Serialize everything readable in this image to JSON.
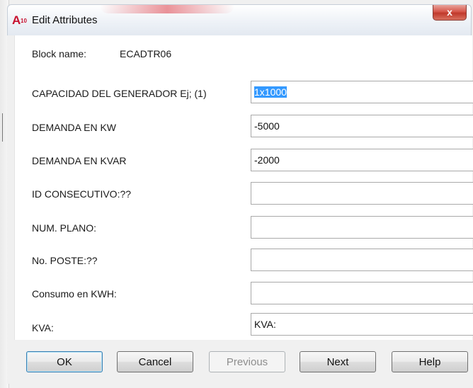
{
  "window": {
    "title": "Edit Attributes",
    "icon_text": "A",
    "icon_subtext": "10",
    "close_label": "x"
  },
  "block": {
    "label": "Block name:",
    "value": "ECADTR06"
  },
  "attributes": [
    {
      "label": "CAPACIDAD DEL GENERADOR Ej; (1)",
      "value": "1x1000",
      "selected": true
    },
    {
      "label": "DEMANDA EN KW",
      "value": "-5000"
    },
    {
      "label": "DEMANDA EN KVAR",
      "value": "-2000"
    },
    {
      "label": "ID CONSECUTIVO:??",
      "value": ""
    },
    {
      "label": "NUM. PLANO:",
      "value": ""
    },
    {
      "label": "No. POSTE:??",
      "value": ""
    },
    {
      "label": "Consumo en KWH:",
      "value": ""
    },
    {
      "label": "KVA:",
      "value": "KVA:"
    }
  ],
  "buttons": {
    "ok": "OK",
    "cancel": "Cancel",
    "previous": "Previous",
    "next": "Next",
    "help": "Help"
  },
  "colors": {
    "selection": "#3399ff",
    "close": "#c0392b"
  }
}
